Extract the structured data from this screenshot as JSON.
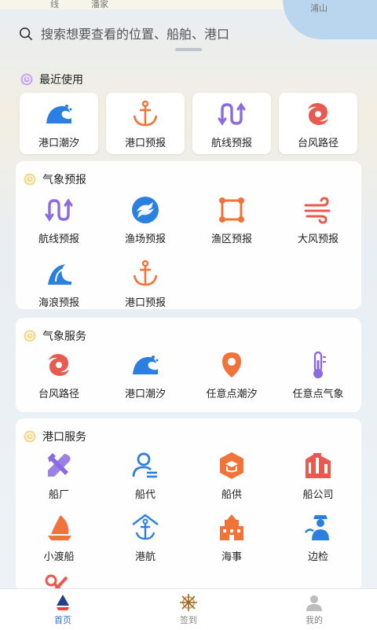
{
  "search": {
    "placeholder": "搜索想要查看的位置、船舶、港口"
  },
  "map": {
    "labels": [
      "线",
      "潘家",
      "浦山"
    ]
  },
  "recent": {
    "title": "最近使用",
    "items": [
      {
        "label": "港口潮汐",
        "icon": "wave-icon"
      },
      {
        "label": "港口预报",
        "icon": "anchor-icon"
      },
      {
        "label": "航线预报",
        "icon": "route-icon"
      },
      {
        "label": "台风路径",
        "icon": "typhoon-icon"
      }
    ]
  },
  "weather_forecast": {
    "title": "气象预报",
    "items": [
      {
        "label": "航线预报",
        "icon": "route-icon"
      },
      {
        "label": "渔场预报",
        "icon": "fish-icon"
      },
      {
        "label": "渔区预报",
        "icon": "grid-area-icon"
      },
      {
        "label": "大风预报",
        "icon": "wind-icon"
      },
      {
        "label": "海浪预报",
        "icon": "wave-icon"
      },
      {
        "label": "港口预报",
        "icon": "anchor-icon"
      }
    ]
  },
  "weather_service": {
    "title": "气象服务",
    "items": [
      {
        "label": "台风路径",
        "icon": "typhoon-icon"
      },
      {
        "label": "港口潮汐",
        "icon": "wave-icon"
      },
      {
        "label": "任意点潮汐",
        "icon": "location-pin-icon"
      },
      {
        "label": "任意点气象",
        "icon": "thermometer-icon"
      }
    ]
  },
  "port_service": {
    "title": "港口服务",
    "items": [
      {
        "label": "船厂",
        "icon": "tools-icon"
      },
      {
        "label": "船代",
        "icon": "agent-icon"
      },
      {
        "label": "船供",
        "icon": "supply-box-icon"
      },
      {
        "label": "船公司",
        "icon": "company-building-icon"
      },
      {
        "label": "小渡船",
        "icon": "sailboat-icon"
      },
      {
        "label": "港航",
        "icon": "port-anchor-icon"
      },
      {
        "label": "海事",
        "icon": "maritime-building-icon"
      },
      {
        "label": "边检",
        "icon": "border-officer-icon"
      }
    ]
  },
  "tabbar": {
    "items": [
      {
        "label": "首页",
        "icon": "home-sail-icon"
      },
      {
        "label": "签到",
        "icon": "helm-wheel-icon"
      },
      {
        "label": "我的",
        "icon": "user-icon"
      }
    ]
  },
  "colors": {
    "orange": "#f0743a",
    "blue": "#2a7fe0",
    "purple": "#8a6be0",
    "red": "#e85a4f",
    "active": "#2b6fd6"
  }
}
